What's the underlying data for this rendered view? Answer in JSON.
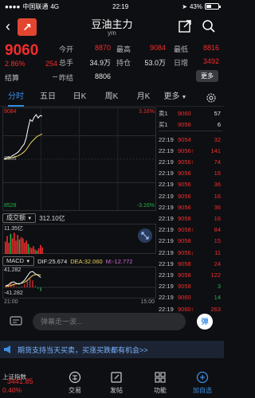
{
  "status_bar": {
    "carrier": "中国联通",
    "network": "4G",
    "time": "22:19",
    "battery": "43%",
    "battery_level": 0.43
  },
  "nav": {
    "app_logo_text": "↗",
    "title": "豆油主力",
    "subtitle": "ym",
    "icons": [
      "back-icon",
      "app-logo-icon",
      "share-icon",
      "search-icon"
    ]
  },
  "quote": {
    "price": "9060",
    "change_pct": "2.86%",
    "change_val": "254",
    "rows": [
      {
        "label1": "今开",
        "val1": "8870",
        "label2": "最高",
        "val2": "9084",
        "label3": "最低",
        "val3": "8816"
      },
      {
        "label1": "总手",
        "val1": "34.9万",
        "label2": "持仓",
        "val2": "53.0万",
        "label3": "日增",
        "val3": "3492"
      },
      {
        "label1": "结算",
        "val1": "--",
        "label2": "昨结",
        "val2": "8806",
        "label3": "",
        "val3": ""
      }
    ],
    "more_label": "更多"
  },
  "tabs": {
    "items": [
      "分时",
      "五日",
      "日K",
      "周K",
      "月K",
      "更多"
    ],
    "active_index": 0
  },
  "chart": {
    "high_label": "9084",
    "low_label": "8528",
    "mid_label": "8806",
    "high_pct": "3.16%",
    "low_pct": "-3.16%",
    "price_series": [
      8806,
      8812,
      8820,
      8816,
      8826,
      8832,
      8840,
      8848,
      8862,
      8880,
      8895,
      8930,
      8990,
      9040,
      9030,
      9055,
      9070,
      9050,
      9065,
      9060
    ],
    "avg_series": [
      8806,
      8808,
      8810,
      8812,
      8815,
      8818,
      8822,
      8826,
      8832,
      8840,
      8850,
      8862,
      8880,
      8898,
      8912,
      8924,
      8936,
      8944,
      8950,
      8956
    ]
  },
  "orderbook": {
    "asks": [
      {
        "label": "卖1",
        "price": "9060",
        "vol": "57"
      }
    ],
    "bids": [
      {
        "label": "买1",
        "price": "9058",
        "vol": "6"
      }
    ],
    "trades": [
      {
        "t": "22:19",
        "p": "9054",
        "v": "32",
        "dir": "red",
        "arrow": ""
      },
      {
        "t": "22:19",
        "p": "9056",
        "v": "141",
        "dir": "red",
        "arrow": "↑"
      },
      {
        "t": "22:19",
        "p": "9056",
        "v": "74",
        "dir": "red",
        "arrow": "↑"
      },
      {
        "t": "22:19",
        "p": "9056",
        "v": "16",
        "dir": "red",
        "arrow": ""
      },
      {
        "t": "22:19",
        "p": "9056",
        "v": "36",
        "dir": "red",
        "arrow": ""
      },
      {
        "t": "22:19",
        "p": "9056",
        "v": "16",
        "dir": "red",
        "arrow": ""
      },
      {
        "t": "22:19",
        "p": "9056",
        "v": "36",
        "dir": "red",
        "arrow": ""
      },
      {
        "t": "22:19",
        "p": "9058",
        "v": "16",
        "dir": "red",
        "arrow": ""
      },
      {
        "t": "22:19",
        "p": "9058",
        "v": "84",
        "dir": "red",
        "arrow": "↑"
      },
      {
        "t": "22:19",
        "p": "9058",
        "v": "15",
        "dir": "red",
        "arrow": ""
      },
      {
        "t": "22:19",
        "p": "9056",
        "v": "11",
        "dir": "red",
        "arrow": "↓"
      },
      {
        "t": "22:19",
        "p": "9058",
        "v": "24",
        "dir": "red",
        "arrow": ""
      },
      {
        "t": "22:19",
        "p": "9058",
        "v": "122",
        "dir": "red",
        "arrow": ""
      },
      {
        "t": "22:19",
        "p": "9058",
        "v": "3",
        "dir": "green",
        "arrow": ""
      },
      {
        "t": "22:19",
        "p": "9060",
        "v": "14",
        "dir": "green",
        "arrow": ""
      },
      {
        "t": "22:19",
        "p": "9060",
        "v": "263",
        "dir": "red",
        "arrow": "↑"
      }
    ]
  },
  "volume": {
    "tag": "成交额",
    "value": "312.10亿",
    "max_label": "11.35亿",
    "bars": [
      0.55,
      0.8,
      0.5,
      0.9,
      0.7,
      0.95,
      0.6,
      0.85,
      0.65,
      0.75,
      0.7,
      0.5,
      0.6,
      0.45,
      0.3,
      0.25,
      0.35,
      0.2,
      0.15,
      0.25,
      0.4,
      0.3
    ]
  },
  "macd": {
    "tag": "MACD",
    "dif_label": "DIF:25.674",
    "dea_label": "DEA:32.060",
    "m_label": "M:-12.772",
    "top_label": "41.282",
    "bottom_label": "-41.282",
    "dif_series": [
      0.1,
      0.15,
      0.3,
      0.35,
      0.25,
      0.2,
      0.3,
      0.45,
      0.7,
      0.95,
      1.0,
      0.85,
      0.75,
      0.62
    ],
    "dea_series": [
      0.05,
      0.08,
      0.12,
      0.18,
      0.22,
      0.24,
      0.26,
      0.32,
      0.44,
      0.6,
      0.74,
      0.8,
      0.8,
      0.77
    ],
    "hist": [
      0.1,
      0.15,
      0.35,
      0.3,
      0.05,
      -0.05,
      0.08,
      0.25,
      0.5,
      0.7,
      0.55,
      0.1,
      -0.1,
      -0.3
    ]
  },
  "time_axis": {
    "start": "21:00",
    "end": "15:00"
  },
  "comment": {
    "placeholder": "弹幕走一波...",
    "danmu_label": "弹"
  },
  "banner": {
    "text": "期货支持当天买卖，买涨买跌都有机会>>"
  },
  "bottom": {
    "index_name": "上证指数",
    "index_value": "3441.85",
    "index_pct": "0.40%",
    "items": [
      "交易",
      "发帖",
      "功能",
      "加自选"
    ]
  },
  "colors": {
    "up": "#f02d2d",
    "down": "#20b34a",
    "accent": "#3a8ee6",
    "avg": "#e8d35a",
    "price": "#ffffff"
  }
}
